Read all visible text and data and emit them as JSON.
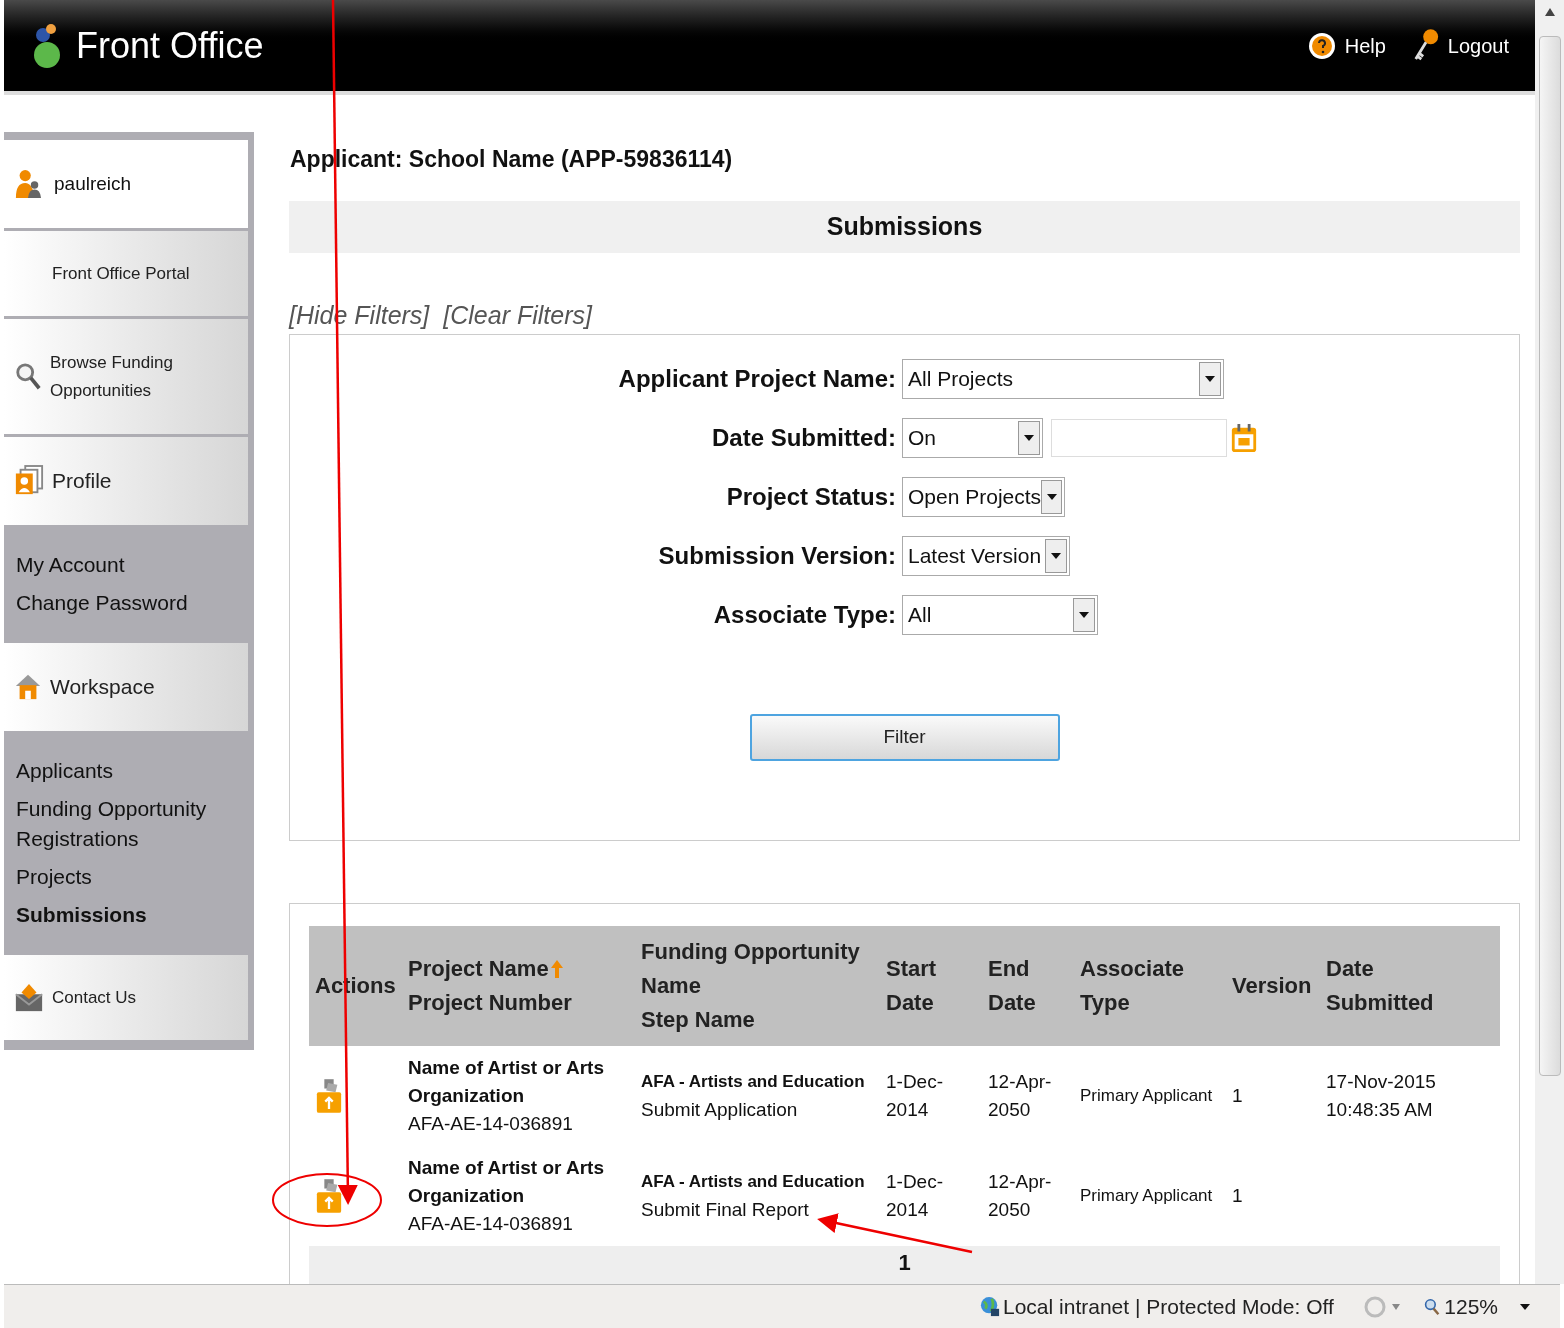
{
  "header": {
    "title": "Front Office",
    "links": [
      {
        "label": "Help",
        "kind": "help"
      },
      {
        "label": "Logout",
        "kind": "logout"
      }
    ]
  },
  "sidebar": [
    {
      "kind": "user",
      "label": "paulreich"
    },
    {
      "kind": "tile",
      "label": "Front Office Portal"
    },
    {
      "kind": "tile",
      "label": "Browse Funding Opportunities"
    },
    {
      "kind": "tile",
      "label": "Profile"
    },
    {
      "kind": "group",
      "items": [
        {
          "label": "My Account",
          "selected": false
        },
        {
          "label": "Change Password",
          "selected": false
        }
      ]
    },
    {
      "kind": "tile",
      "label": "Workspace"
    },
    {
      "kind": "group",
      "items": [
        {
          "label": "Applicants",
          "selected": false
        },
        {
          "label": "Funding Opportunity Registrations",
          "selected": false
        },
        {
          "label": "Projects",
          "selected": false
        },
        {
          "label": "Submissions",
          "selected": true
        }
      ]
    },
    {
      "kind": "tile",
      "label": "Contact Us"
    }
  ],
  "applicant_heading": "Applicant: School Name (APP-59836114)",
  "panel_title": "Submissions",
  "filter_links": [
    "[Hide Filters]",
    "[Clear Filters]"
  ],
  "filters": [
    {
      "label": "Applicant Project Name:",
      "kind": "select",
      "value": "All Projects"
    },
    {
      "label": "Date Submitted:",
      "kind": "date",
      "value": "On"
    },
    {
      "label": "Project Status:",
      "kind": "select",
      "value": "Open Projects"
    },
    {
      "label": "Submission Version:",
      "kind": "select",
      "value": "Latest Version"
    },
    {
      "label": "Associate Type:",
      "kind": "select",
      "value": "All"
    }
  ],
  "filter_button": "Filter",
  "table": {
    "columns": [
      {
        "lines": [
          "Actions"
        ],
        "sorted": false
      },
      {
        "lines": [
          "Project Name",
          "Project Number"
        ],
        "sorted": true
      },
      {
        "lines": [
          "Funding Opportunity",
          "Name",
          "Step Name"
        ],
        "sorted": false
      },
      {
        "lines": [
          "Start",
          "Date"
        ],
        "sorted": false
      },
      {
        "lines": [
          "End",
          "Date"
        ],
        "sorted": false
      },
      {
        "lines": [
          "Associate",
          "Type"
        ],
        "sorted": false
      },
      {
        "lines": [
          "Version"
        ],
        "sorted": false
      },
      {
        "lines": [
          "Date",
          "Submitted"
        ],
        "sorted": false
      }
    ],
    "rows": [
      {
        "project_name": "Name of Artist or Arts Organization",
        "project_number": "AFA-AE-14-036891",
        "funding_opportunity": "AFA - Artists and Education",
        "step_name": "Submit Application",
        "start_date": "1-Dec-2014",
        "end_date": "12-Apr-2050",
        "associate_type": "Primary Applicant",
        "version": "1",
        "date_submitted": [
          "17-Nov-2015",
          "10:48:35 AM"
        ]
      },
      {
        "project_name": "Name of Artist or Arts Organization",
        "project_number": "AFA-AE-14-036891",
        "funding_opportunity": "AFA - Artists and Education",
        "step_name": "Submit Final Report",
        "start_date": "1-Dec-2014",
        "end_date": "12-Apr-2050",
        "associate_type": "Primary Applicant",
        "version": "1"
      }
    ],
    "pager": "1"
  },
  "status_bar": {
    "zone": "Local intranet | Protected Mode: Off",
    "zoom": "125%"
  }
}
